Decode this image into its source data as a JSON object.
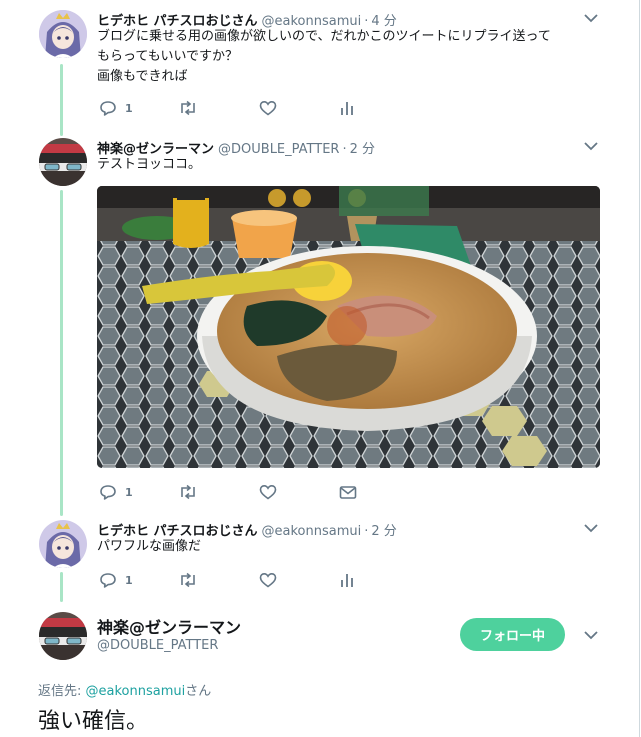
{
  "tweets": [
    {
      "name": "ヒデホヒ パチスロおじさん",
      "handle": "@eakonnsamui",
      "dot": "·",
      "time": "4 分",
      "text_lines": [
        "ブログに乗せる用の画像が欲しいので、だれかこのツイートにリプライ送って",
        "もらってもいいですか？",
        "画像もできれば"
      ],
      "reply_count": "1"
    },
    {
      "name": "神楽@ゼンラーマン",
      "handle": "@DOUBLE_PATTER",
      "dot": "·",
      "time": "2 分",
      "text_lines": [
        "テストヨッココ。"
      ],
      "reply_count": "1"
    },
    {
      "name": "ヒデホヒ パチスロおじさん",
      "handle": "@eakonnsamui",
      "dot": "·",
      "time": "2 分",
      "text_lines": [
        "パワフルな画像だ"
      ],
      "reply_count": "1"
    }
  ],
  "focused": {
    "name": "神楽@ゼンラーマン",
    "handle": "@DOUBLE_PATTER",
    "follow_label": "フォロー中",
    "reply_prefix": "返信先: ",
    "reply_mention": "@eakonnsamui",
    "reply_suffix": "さん",
    "text": "強い確信。"
  },
  "colors": {
    "thread_line": "#a9e5c6",
    "follow_button": "#4ed19d",
    "mention": "#1da1a0"
  }
}
